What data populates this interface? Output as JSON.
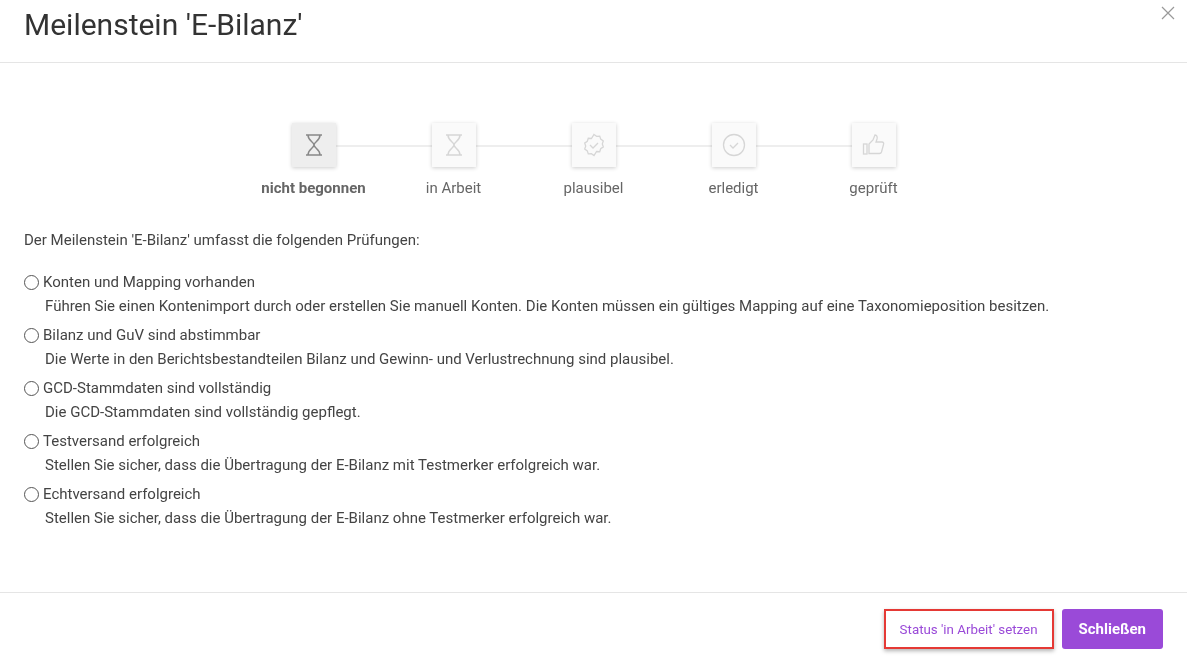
{
  "dialog": {
    "title": "Meilenstein 'E-Bilanz'"
  },
  "steps": [
    {
      "label": "nicht begonnen",
      "kind": "hourglass",
      "selected": true
    },
    {
      "label": "in Arbeit",
      "kind": "hourglass",
      "selected": false
    },
    {
      "label": "plausibel",
      "kind": "badge",
      "selected": false
    },
    {
      "label": "erledigt",
      "kind": "check",
      "selected": false
    },
    {
      "label": "geprüft",
      "kind": "thumb",
      "selected": false
    }
  ],
  "intro": "Der Meilenstein 'E-Bilanz' umfasst die folgenden Prüfungen:",
  "checks": [
    {
      "title": "Konten und Mapping vorhanden",
      "description": "Führen Sie einen Kontenimport durch oder erstellen Sie manuell Konten. Die Konten müssen ein gültiges Mapping auf eine Taxonomieposition besitzen.",
      "checked": false
    },
    {
      "title": "Bilanz und GuV sind abstimmbar",
      "description": "Die Werte in den Berichtsbestandteilen Bilanz und Gewinn- und Verlustrechnung sind plausibel.",
      "checked": false
    },
    {
      "title": "GCD-Stammdaten sind vollständig",
      "description": "Die GCD-Stammdaten sind vollständig gepflegt.",
      "checked": false
    },
    {
      "title": "Testversand erfolgreich",
      "description": "Stellen Sie sicher, dass die Übertragung der E-Bilanz mit Testmerker erfolgreich war.",
      "checked": false
    },
    {
      "title": "Echtversand erfolgreich",
      "description": "Stellen Sie sicher, dass die Übertragung der E-Bilanz ohne Testmerker erfolgreich war.",
      "checked": false
    }
  ],
  "buttons": {
    "secondary": "Status 'in Arbeit' setzen",
    "primary": "Schließen"
  }
}
